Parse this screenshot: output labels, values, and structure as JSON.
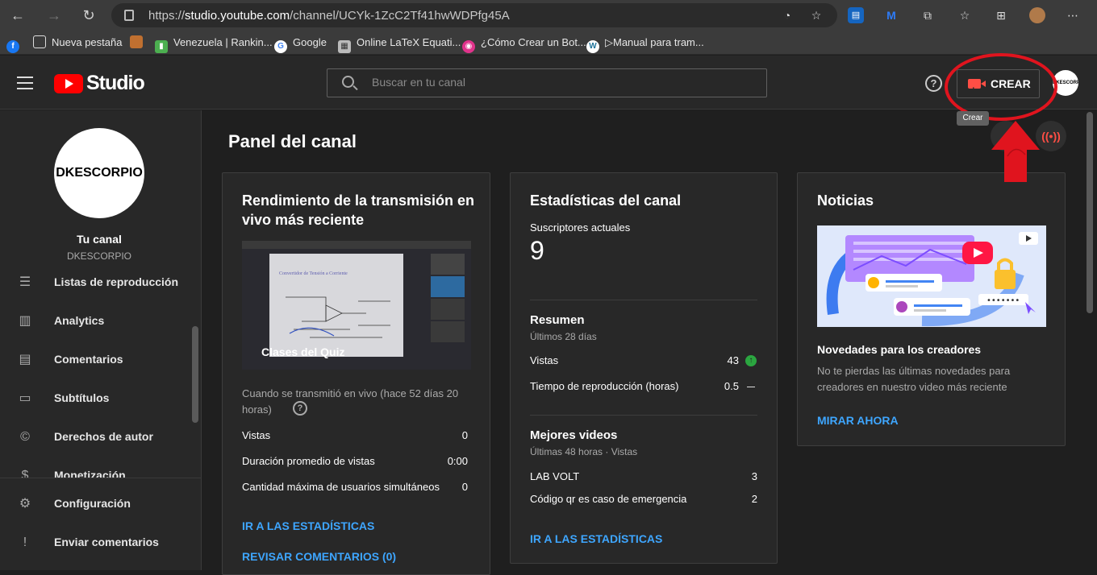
{
  "browser": {
    "url_prefix": "https://",
    "url_domain": "studio.youtube.com",
    "url_path": "/channel/UCYk-1ZcC2Tf41hwWDPfg45A"
  },
  "bookmarks": [
    {
      "label": "",
      "icon": "facebook-icon",
      "color": "#1877f2"
    },
    {
      "label": "Nueva pestaña",
      "icon": "page-icon",
      "color": "#e0e0e0"
    },
    {
      "label": "",
      "icon": "bookmark-icon",
      "color": "#c07030"
    },
    {
      "label": "Venezuela | Rankin...",
      "icon": "chart-icon",
      "color": "#4caf50"
    },
    {
      "label": "Google",
      "icon": "google-icon",
      "color": "#ffffff"
    },
    {
      "label": "Online LaTeX Equati...",
      "icon": "latex-icon",
      "color": "#bbbbbb"
    },
    {
      "label": "¿Cómo Crear un Bot...",
      "icon": "bot-icon",
      "color": "#e0338b"
    },
    {
      "label": "▷Manual para tram...",
      "icon": "wordpress-icon",
      "color": "#ffffff"
    }
  ],
  "header": {
    "studio_label": "Studio",
    "search_placeholder": "Buscar en tu canal",
    "help_glyph": "?",
    "create_label": "CREAR",
    "create_tooltip": "Crear",
    "avatar_text": "DKESCORPIO"
  },
  "sidebar": {
    "avatar_text": "DKESCORPIO",
    "your_channel": "Tu canal",
    "channel_name": "DKESCORPIO",
    "items": [
      {
        "label": "Listas de reproducción",
        "icon": "playlist-icon"
      },
      {
        "label": "Analytics",
        "icon": "analytics-icon"
      },
      {
        "label": "Comentarios",
        "icon": "comments-icon"
      },
      {
        "label": "Subtítulos",
        "icon": "subtitles-icon"
      },
      {
        "label": "Derechos de autor",
        "icon": "copyright-icon"
      },
      {
        "label": "Monetización",
        "icon": "monetization-icon"
      }
    ],
    "bottom_items": [
      {
        "label": "Configuración",
        "icon": "settings-icon"
      },
      {
        "label": "Enviar comentarios",
        "icon": "feedback-icon"
      }
    ]
  },
  "main": {
    "page_title": "Panel del canal",
    "live_card": {
      "title": "Rendimiento de la transmisión en vivo más reciente",
      "thumbnail_caption": "Clases del Quiz",
      "thumbnail_doc_title": "Convertidor de Tensión a Corriente",
      "streamed_text": "Cuando se transmitió en vivo (hace 52 días 20 horas)",
      "rows": [
        {
          "label": "Vistas",
          "value": "0"
        },
        {
          "label": "Duración promedio de vistas",
          "value": "0:00"
        },
        {
          "label": "Cantidad máxima de usuarios simultáneos",
          "value": "0"
        }
      ],
      "link_stats": "IR A LAS ESTADÍSTICAS",
      "link_comments": "REVISAR COMENTARIOS (0)"
    },
    "stats_card": {
      "title": "Estadísticas del canal",
      "subs_label": "Suscriptores actuales",
      "subs_value": "9",
      "summary_title": "Resumen",
      "summary_period": "Últimos 28 días",
      "summary_rows": [
        {
          "label": "Vistas",
          "value": "43",
          "trend": "up"
        },
        {
          "label": "Tiempo de reproducción (horas)",
          "value": "0.5",
          "trend": "flat"
        }
      ],
      "top_title": "Mejores videos",
      "top_period": "Últimas 48 horas · Vistas",
      "top_rows": [
        {
          "label": "LAB VOLT",
          "value": "3"
        },
        {
          "label": "Código qr es caso de emergencia",
          "value": "2"
        }
      ],
      "link_stats": "IR A LAS ESTADÍSTICAS"
    },
    "news_card": {
      "title": "Noticias",
      "headline": "Novedades para los creadores",
      "body": "No te pierdas las últimas novedades para creadores en nuestro video más reciente",
      "link": "MIRAR AHORA"
    }
  },
  "colors": {
    "accent_link": "#3ea6ff",
    "brand_red": "#ff0000",
    "annotation_red": "#e0141e"
  }
}
